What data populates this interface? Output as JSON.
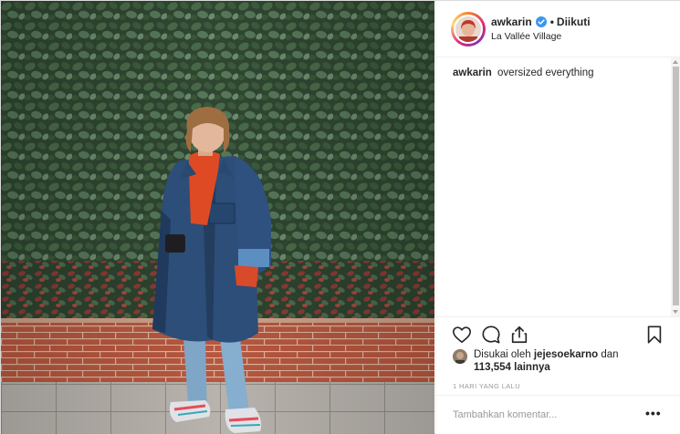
{
  "post": {
    "username": "awkarin",
    "verified": true,
    "separator": "•",
    "follow_status": "Diikuti",
    "location": "La Vallée Village",
    "caption_user": "awkarin",
    "caption_text": "oversized everything",
    "liked_by_prefix": "Disukai oleh",
    "liked_by_user": "jejesoekarno",
    "liked_by_join": "dan",
    "likes_count": "113,554 lainnya",
    "timestamp": "1 HARI YANG LALU",
    "comment_placeholder": "Tambahkan komentar...",
    "more_label": "•••"
  },
  "icons": {
    "like": "heart-outline-icon",
    "comment": "comment-bubble-icon",
    "share": "share-arrow-icon",
    "save": "bookmark-outline-icon",
    "verified": "verified-badge-icon"
  },
  "colors": {
    "verified_blue": "#3897f0",
    "text": "#262626",
    "muted": "#999999",
    "border": "#efefef"
  }
}
